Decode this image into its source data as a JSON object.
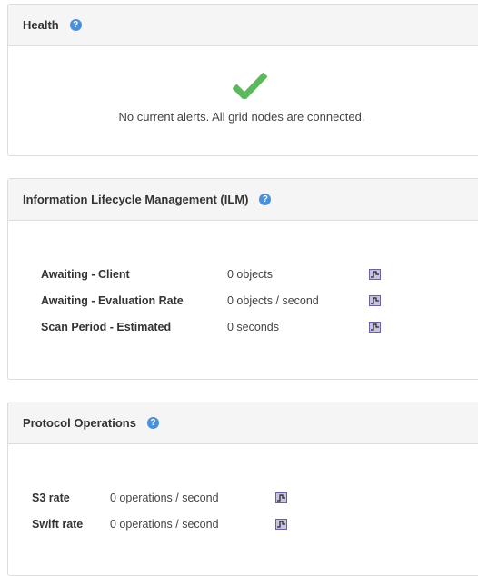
{
  "health": {
    "title": "Health",
    "help_icon": "question-circle-icon",
    "status_icon": "checkmark-icon",
    "message": "No current alerts. All grid nodes are connected."
  },
  "ilm": {
    "title": "Information Lifecycle Management (ILM)",
    "help_icon": "question-circle-icon",
    "rows": [
      {
        "label": "Awaiting - Client",
        "value": "0 objects",
        "icon": "chart-icon"
      },
      {
        "label": "Awaiting - Evaluation Rate",
        "value": "0 objects / second",
        "icon": "chart-icon"
      },
      {
        "label": "Scan Period - Estimated",
        "value": "0 seconds",
        "icon": "chart-icon"
      }
    ]
  },
  "protocol": {
    "title": "Protocol Operations",
    "help_icon": "question-circle-icon",
    "rows": [
      {
        "label": "S3 rate",
        "value": "0 operations / second",
        "icon": "chart-icon"
      },
      {
        "label": "Swift rate",
        "value": "0 operations / second",
        "icon": "chart-icon"
      }
    ]
  },
  "colors": {
    "accent": "#4a90d9",
    "success": "#5cb85c",
    "panel_heading_bg": "#f5f5f5",
    "border": "#dddddd"
  }
}
